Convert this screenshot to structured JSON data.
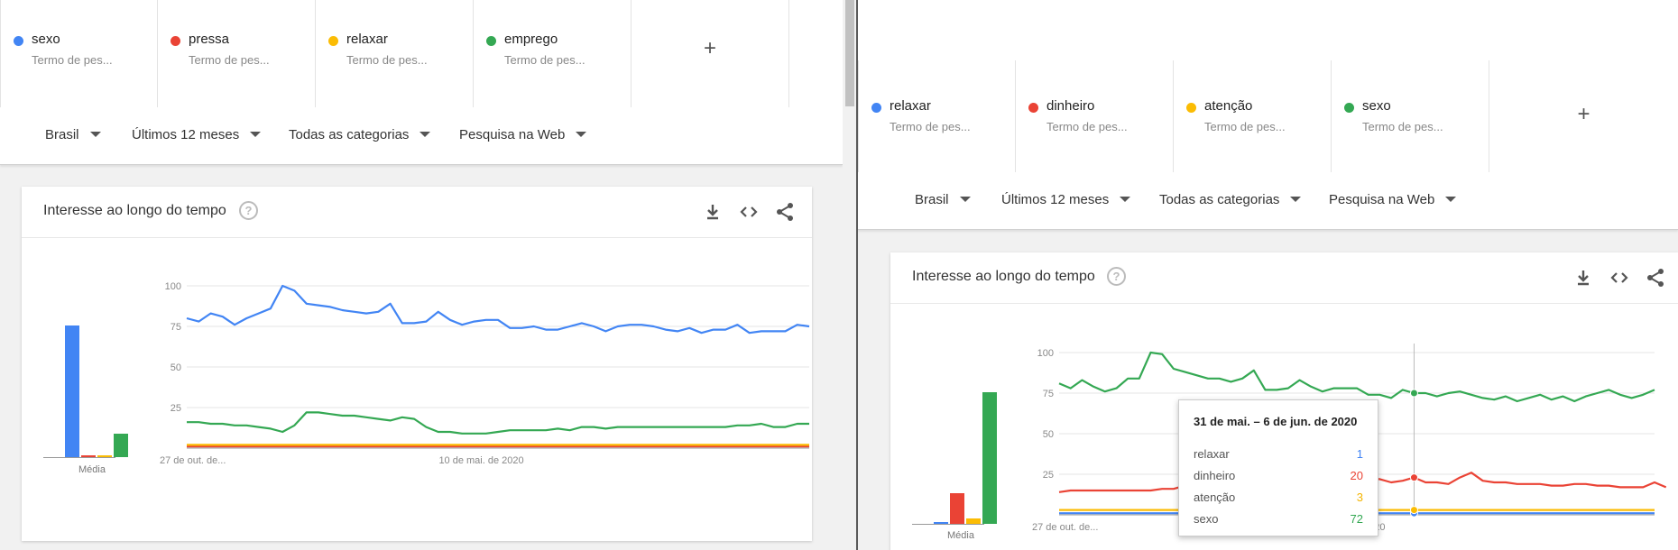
{
  "left": {
    "terms": [
      {
        "name": "sexo",
        "sub": "Termo de pes...",
        "color": "#4285f4"
      },
      {
        "name": "pressa",
        "sub": "Termo de pes...",
        "color": "#ea4335"
      },
      {
        "name": "relaxar",
        "sub": "Termo de pes...",
        "color": "#fbbc04"
      },
      {
        "name": "emprego",
        "sub": "Termo de pes...",
        "color": "#34a853"
      }
    ],
    "add_label": "+",
    "filters": [
      {
        "label": "Brasil"
      },
      {
        "label": "Últimos 12 meses"
      },
      {
        "label": "Todas as categorias"
      },
      {
        "label": "Pesquisa na Web"
      }
    ],
    "card": {
      "title": "Interesse ao longo do tempo",
      "help": "?",
      "avg_label": "Média",
      "averages": [
        78,
        1,
        1,
        14
      ]
    },
    "chart_data": {
      "type": "line",
      "x_tick_labels": [
        "27 de out. de...",
        "10 de mai. de 2020"
      ],
      "y_ticks": [
        25,
        50,
        75,
        100
      ],
      "ylim": [
        0,
        100
      ],
      "series": [
        {
          "name": "sexo",
          "color": "#4285f4",
          "values": [
            80,
            78,
            83,
            81,
            76,
            80,
            83,
            86,
            100,
            97,
            89,
            88,
            87,
            85,
            84,
            83,
            84,
            89,
            77,
            77,
            78,
            84,
            79,
            76,
            78,
            79,
            79,
            74,
            74,
            75,
            73,
            73,
            75,
            77,
            75,
            72,
            75,
            76,
            76,
            75,
            73,
            72,
            74,
            71,
            73,
            73,
            76,
            71,
            72,
            72,
            72,
            76,
            75
          ]
        },
        {
          "name": "pressa",
          "color": "#ea4335",
          "values": [
            1,
            1,
            1,
            1,
            1,
            1,
            1,
            1,
            1,
            1,
            1,
            1,
            1,
            1,
            1,
            1,
            1,
            1,
            1,
            1,
            1,
            1,
            1,
            1,
            1,
            1,
            1,
            1,
            1,
            1,
            1,
            1,
            1,
            1,
            1,
            1,
            1,
            1,
            1,
            1,
            1,
            1,
            1,
            1,
            1,
            1,
            1,
            1,
            1,
            1,
            1,
            1,
            1
          ]
        },
        {
          "name": "relaxar",
          "color": "#fbbc04",
          "values": [
            2,
            2,
            2,
            2,
            2,
            2,
            2,
            2,
            2,
            2,
            2,
            2,
            2,
            2,
            2,
            2,
            2,
            2,
            2,
            2,
            2,
            2,
            2,
            2,
            2,
            2,
            2,
            2,
            2,
            2,
            2,
            2,
            2,
            2,
            2,
            2,
            2,
            2,
            2,
            2,
            2,
            2,
            2,
            2,
            2,
            2,
            2,
            2,
            2,
            2,
            2,
            2,
            2
          ]
        },
        {
          "name": "emprego",
          "color": "#34a853",
          "values": [
            16,
            16,
            15,
            15,
            14,
            14,
            13,
            12,
            10,
            14,
            22,
            22,
            21,
            20,
            20,
            19,
            18,
            17,
            19,
            18,
            13,
            10,
            10,
            9,
            9,
            9,
            10,
            11,
            11,
            11,
            11,
            12,
            11,
            13,
            13,
            12,
            13,
            13,
            13,
            13,
            13,
            13,
            13,
            13,
            13,
            13,
            14,
            14,
            15,
            13,
            13,
            15,
            15
          ]
        }
      ]
    }
  },
  "right": {
    "terms": [
      {
        "name": "relaxar",
        "sub": "Termo de pes...",
        "color": "#4285f4"
      },
      {
        "name": "dinheiro",
        "sub": "Termo de pes...",
        "color": "#ea4335"
      },
      {
        "name": "atenção",
        "sub": "Termo de pes...",
        "color": "#fbbc04"
      },
      {
        "name": "sexo",
        "sub": "Termo de pes...",
        "color": "#34a853"
      }
    ],
    "add_label": "+",
    "filters": [
      {
        "label": "Brasil"
      },
      {
        "label": "Últimos 12 meses"
      },
      {
        "label": "Todas as categorias"
      },
      {
        "label": "Pesquisa na Web"
      }
    ],
    "card": {
      "title": "Interesse ao longo do tempo",
      "help": "?",
      "avg_label": "Média",
      "averages": [
        1,
        18,
        3,
        78
      ]
    },
    "chart_data": {
      "type": "line",
      "x_tick_labels": [
        "27 de out. de...",
        "10 de mai. de 2020"
      ],
      "y_ticks": [
        25,
        50,
        75,
        100
      ],
      "ylim": [
        0,
        100
      ],
      "series": [
        {
          "name": "relaxar",
          "color": "#4285f4",
          "values": [
            1,
            1,
            1,
            1,
            1,
            1,
            1,
            1,
            1,
            1,
            1,
            1,
            1,
            1,
            1,
            1,
            1,
            1,
            1,
            1,
            1,
            1,
            1,
            1,
            1,
            1,
            1,
            1,
            1,
            1,
            1,
            1,
            1,
            1,
            1,
            1,
            1,
            1,
            1,
            1,
            1,
            1,
            1,
            1,
            1,
            1,
            1,
            1,
            1,
            1,
            1,
            1,
            1
          ]
        },
        {
          "name": "dinheiro",
          "color": "#ea4335",
          "values": [
            14,
            15,
            15,
            15,
            15,
            15,
            15,
            15,
            15,
            16,
            16,
            18,
            17,
            17,
            16,
            16,
            15,
            16,
            16,
            18,
            24,
            26,
            26,
            26,
            26,
            25,
            25,
            22,
            22,
            20,
            21,
            23,
            20,
            20,
            19,
            23,
            26,
            21,
            20,
            20,
            19,
            19,
            19,
            18,
            18,
            19,
            19,
            18,
            18,
            17,
            17,
            17,
            20,
            17
          ]
        },
        {
          "name": "atenção",
          "color": "#fbbc04",
          "values": [
            3,
            3,
            3,
            3,
            3,
            3,
            3,
            3,
            3,
            3,
            3,
            3,
            3,
            3,
            3,
            3,
            3,
            3,
            3,
            3,
            3,
            3,
            3,
            3,
            3,
            3,
            3,
            3,
            3,
            3,
            3,
            3,
            3,
            3,
            3,
            3,
            3,
            3,
            3,
            3,
            3,
            3,
            3,
            3,
            3,
            3,
            3,
            3,
            3,
            3,
            3,
            3,
            3
          ]
        },
        {
          "name": "sexo",
          "color": "#34a853",
          "values": [
            81,
            78,
            83,
            79,
            76,
            78,
            84,
            84,
            100,
            99,
            90,
            88,
            86,
            84,
            84,
            82,
            84,
            89,
            77,
            77,
            78,
            83,
            79,
            76,
            78,
            78,
            78,
            74,
            74,
            72,
            77,
            75,
            75,
            73,
            75,
            76,
            74,
            72,
            71,
            73,
            70,
            72,
            74,
            71,
            73,
            70,
            73,
            75,
            77,
            74,
            72,
            74,
            77
          ]
        }
      ]
    },
    "tooltip": {
      "title": "31 de mai. – 6 de jun. de 2020",
      "rows": [
        {
          "name": "relaxar",
          "value": "1",
          "color": "#4285f4"
        },
        {
          "name": "dinheiro",
          "value": "20",
          "color": "#ea4335"
        },
        {
          "name": "atenção",
          "value": "3",
          "color": "#fbbc04"
        },
        {
          "name": "sexo",
          "value": "72",
          "color": "#34a853"
        }
      ]
    }
  }
}
